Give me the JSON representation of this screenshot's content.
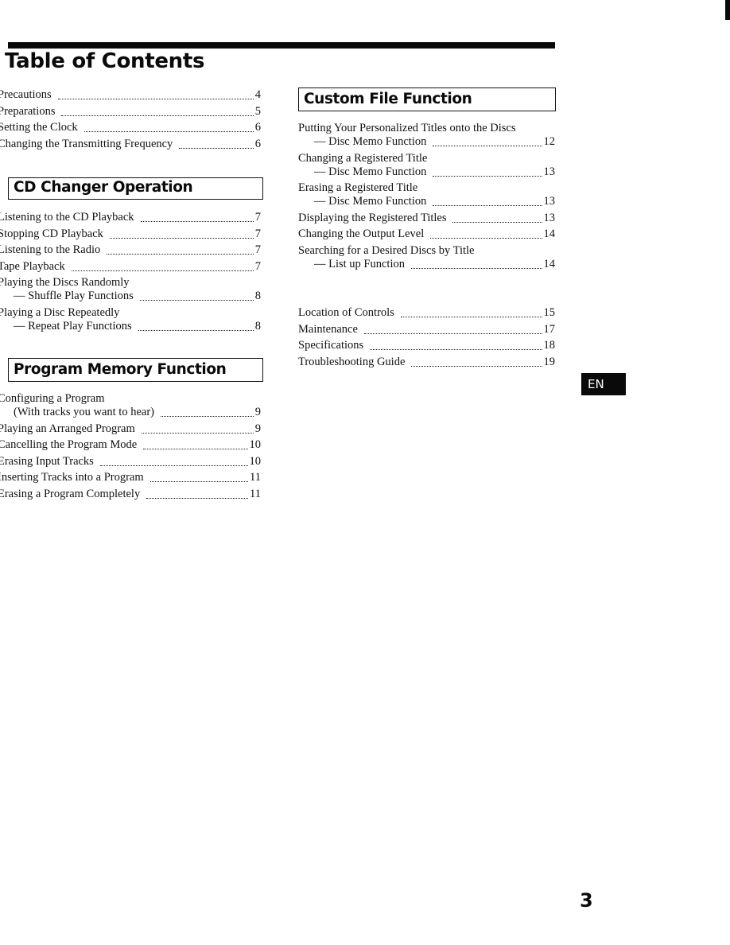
{
  "document": {
    "title": "Table of Contents",
    "page_number": "3",
    "language_tab": "EN"
  },
  "sections": {
    "intro": {
      "entries": [
        {
          "title": "Precautions",
          "page": "4"
        },
        {
          "title": "Preparations",
          "page": "5"
        },
        {
          "title": "Setting the Clock",
          "page": "6"
        },
        {
          "title": "Changing the Transmitting Frequency",
          "page": "6"
        }
      ]
    },
    "cd_changer": {
      "heading": "CD Changer Operation",
      "entries": [
        {
          "title": "Listening to the CD Playback",
          "page": "7"
        },
        {
          "title": "Stopping CD Playback",
          "page": "7"
        },
        {
          "title": "Listening to the Radio",
          "page": "7"
        },
        {
          "title": "Tape Playback",
          "page": "7"
        },
        {
          "title": "Playing the Discs Randomly",
          "subtitle": "— Shuffle Play Functions",
          "page": "8"
        },
        {
          "title": "Playing a Disc Repeatedly",
          "subtitle": "— Repeat Play Functions",
          "page": "8"
        }
      ]
    },
    "program_memory": {
      "heading": "Program Memory Function",
      "entries": [
        {
          "title": "Configuring a Program",
          "subtitle": "(With tracks you want to hear)",
          "page": "9"
        },
        {
          "title": "Playing an Arranged Program",
          "page": "9"
        },
        {
          "title": "Cancelling the Program Mode",
          "page": "10"
        },
        {
          "title": "Erasing Input Tracks",
          "page": "10"
        },
        {
          "title": "Inserting Tracks into a Program",
          "page": "11"
        },
        {
          "title": "Erasing a Program Completely",
          "page": "11"
        }
      ]
    },
    "custom_file": {
      "heading": "Custom File Function",
      "entries": [
        {
          "title": "Putting Your Personalized Titles onto the Discs",
          "subtitle": "— Disc Memo Function",
          "page": "12"
        },
        {
          "title": "Changing a Registered Title",
          "subtitle": "— Disc Memo Function",
          "page": "13"
        },
        {
          "title": "Erasing a Registered Title",
          "subtitle": "— Disc Memo Function",
          "page": "13"
        },
        {
          "title": "Displaying the Registered Titles",
          "page": "13"
        },
        {
          "title": "Changing the Output Level",
          "page": "14"
        },
        {
          "title": "Searching for a Desired Discs by Title",
          "subtitle": "— List up Function",
          "page": "14"
        }
      ]
    },
    "appendix": {
      "entries": [
        {
          "title": "Location of Controls",
          "page": "15"
        },
        {
          "title": "Maintenance",
          "page": "17"
        },
        {
          "title": "Specifications",
          "page": "18"
        },
        {
          "title": "Troubleshooting Guide",
          "page": "19"
        }
      ]
    }
  }
}
